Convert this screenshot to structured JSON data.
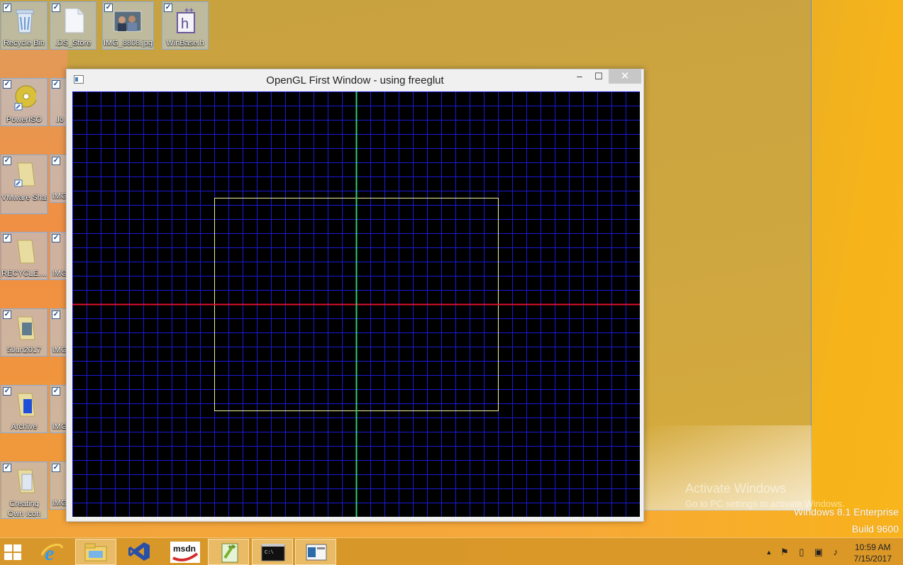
{
  "desktop": {
    "icons": [
      {
        "label": "Recycle Bin",
        "icon": "recycle-bin-icon"
      },
      {
        "label": ".DS_Store",
        "icon": "file-icon"
      },
      {
        "label": "IMG_8808.jpg",
        "icon": "photo-icon"
      },
      {
        "label": "WinBase.h",
        "icon": "cpp-header-icon"
      },
      {
        "label": "PowerISO",
        "icon": "disc-icon"
      },
      {
        "label": ".lo",
        "icon": "file-icon"
      },
      {
        "label": "VMware Share...",
        "icon": "folder-shortcut-icon"
      },
      {
        "label": "IMG",
        "icon": "photo-icon"
      },
      {
        "label": "RECYCLE....",
        "icon": "folder-icon"
      },
      {
        "label": "IMG",
        "icon": "photo-icon"
      },
      {
        "label": "5Jun2017",
        "icon": "folder-icon"
      },
      {
        "label": "IMG",
        "icon": "photo-icon"
      },
      {
        "label": "Archive",
        "icon": "folder-icon"
      },
      {
        "label": "IMG",
        "icon": "photo-icon"
      },
      {
        "label": "Creating",
        "label2": "Own Icon",
        "icon": "folder-icon"
      },
      {
        "label": "IMG",
        "icon": "photo-icon"
      }
    ]
  },
  "window": {
    "title": "OpenGL First Window - using freeglut",
    "minimize": "–",
    "maximize": "☐",
    "close": "✕"
  },
  "canvas": {
    "grid_color": "#1a1ad8",
    "x_axis_color": "#e01030",
    "y_axis_color": "#2ecc71",
    "rect_color": "#f2f2a0",
    "background": "#000000"
  },
  "watermark": {
    "activate": "Activate Windows",
    "go_to": "Go to PC settings to activate Windows.",
    "edition": "Windows 8.1 Enterprise",
    "build": "Build 9600"
  },
  "taskbar": {
    "apps": [
      {
        "name": "internet-explorer-icon"
      },
      {
        "name": "file-explorer-icon"
      },
      {
        "name": "visual-studio-icon"
      },
      {
        "name": "msdn-icon",
        "label": "msdn"
      },
      {
        "name": "notepad-plus-plus-icon"
      },
      {
        "name": "console-icon",
        "label": "C:\\"
      },
      {
        "name": "opengl-window-icon"
      }
    ],
    "time": "10:59 AM",
    "date": "7/15/2017"
  }
}
